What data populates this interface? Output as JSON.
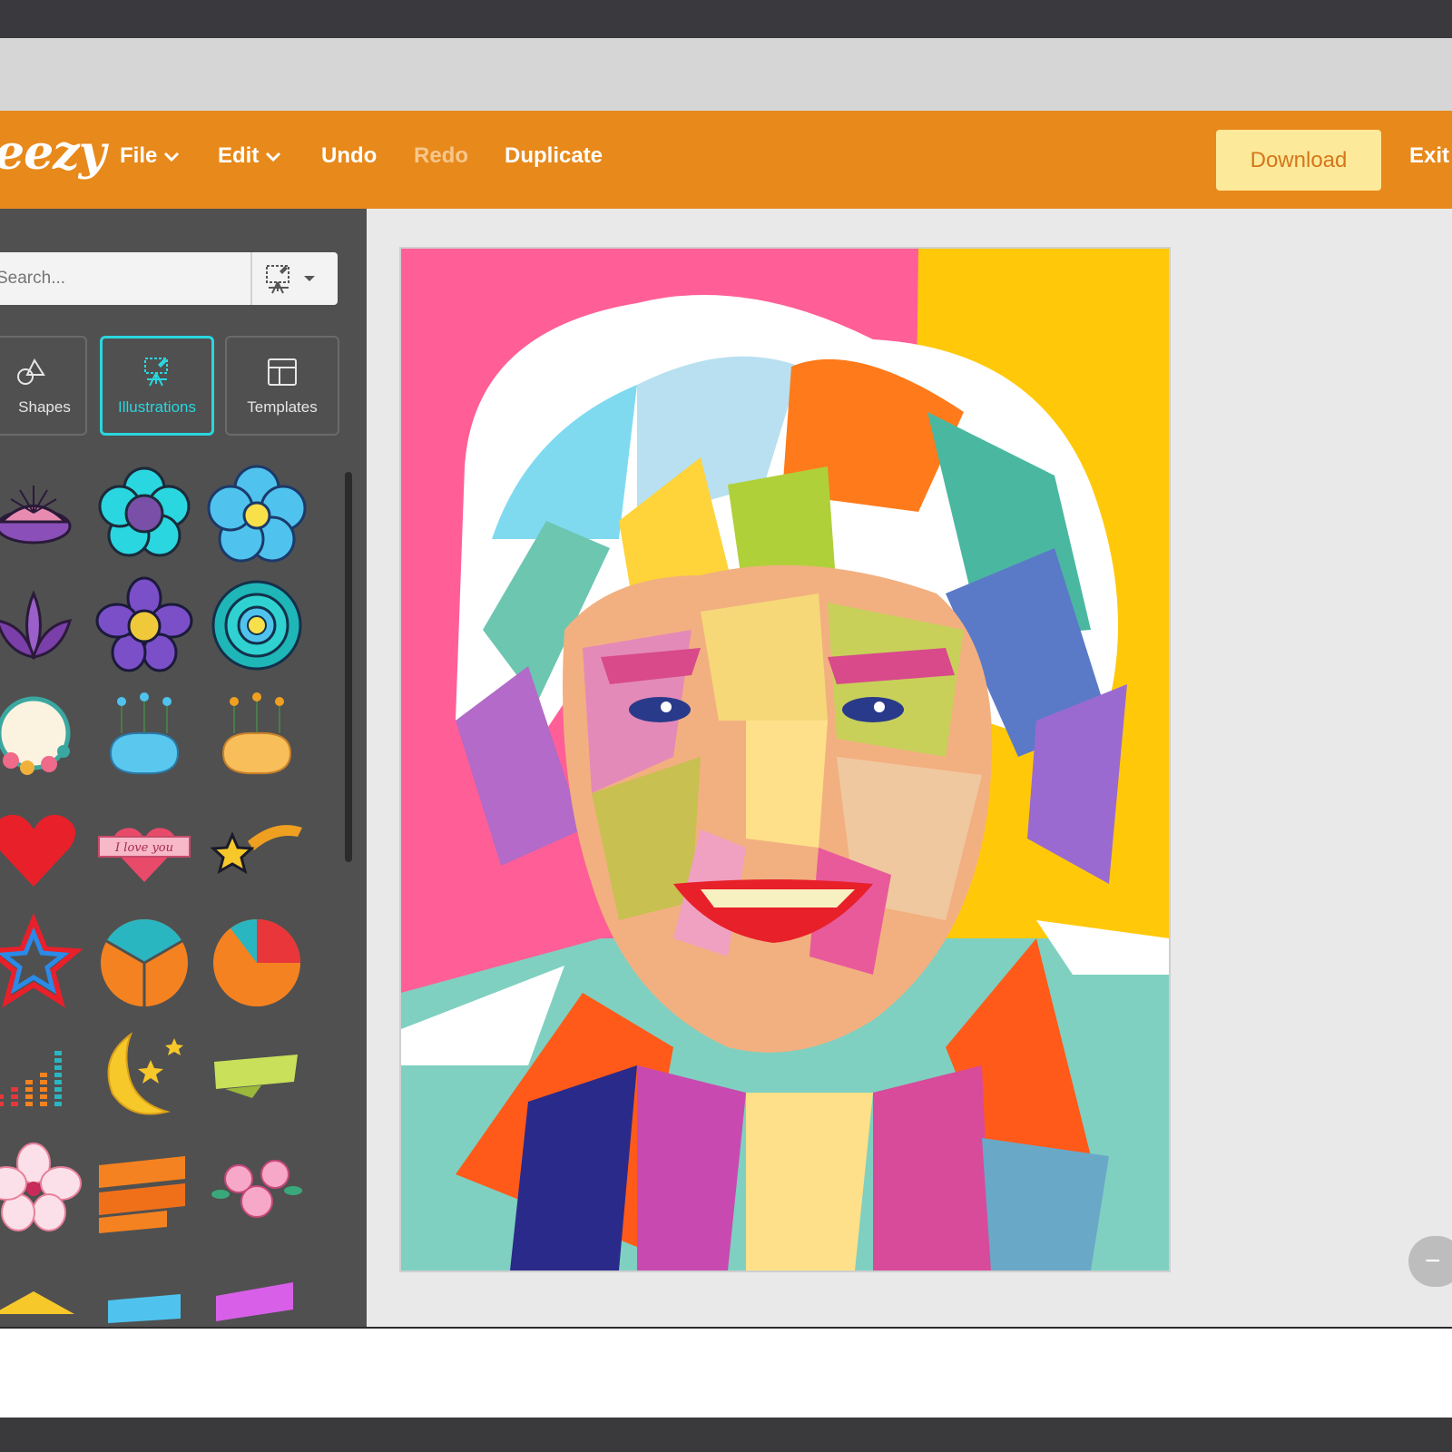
{
  "app": {
    "logo_text": "eezy"
  },
  "menu": {
    "file": "File",
    "edit": "Edit",
    "undo": "Undo",
    "redo": "Redo",
    "duplicate": "Duplicate"
  },
  "actions": {
    "download": "Download",
    "exit": "Exit"
  },
  "sidebar": {
    "search_placeholder": "Search...",
    "tabs": [
      {
        "label": "Shapes",
        "icon": "shapes-icon",
        "active": false
      },
      {
        "label": "Illustrations",
        "icon": "easel-icon",
        "active": true
      },
      {
        "label": "Templates",
        "icon": "layout-icon",
        "active": false
      }
    ],
    "items": [
      "purple-lotus-flower",
      "cyan-flower",
      "blue-flower",
      "purple-lotus",
      "purple-flower",
      "teal-layered-flower",
      "floral-wreath-frame",
      "blue-flower-frame",
      "orange-flower-frame",
      "red-heart",
      "i-love-you-heart",
      "shooting-star",
      "rainbow-star",
      "pie-chart-thirds",
      "pie-chart-quarter",
      "bar-meter",
      "moon-and-stars",
      "green-ribbon-banner",
      "hibiscus-flower",
      "orange-ribbon-banner",
      "pink-flower-bouquet",
      "yellow-ribbon",
      "blue-ribbon",
      "purple-ribbon"
    ],
    "heart_text": "I love you"
  },
  "canvas": {
    "artwork": "wpap-style-colorful-portrait"
  },
  "zoom": {
    "out_label": "−"
  },
  "colors": {
    "brand_orange": "#e8891b",
    "download_bg": "#fde99a",
    "accent_cyan": "#2ad6df",
    "sidebar_bg": "#505050",
    "canvas_bg": "#e9e9ea"
  }
}
